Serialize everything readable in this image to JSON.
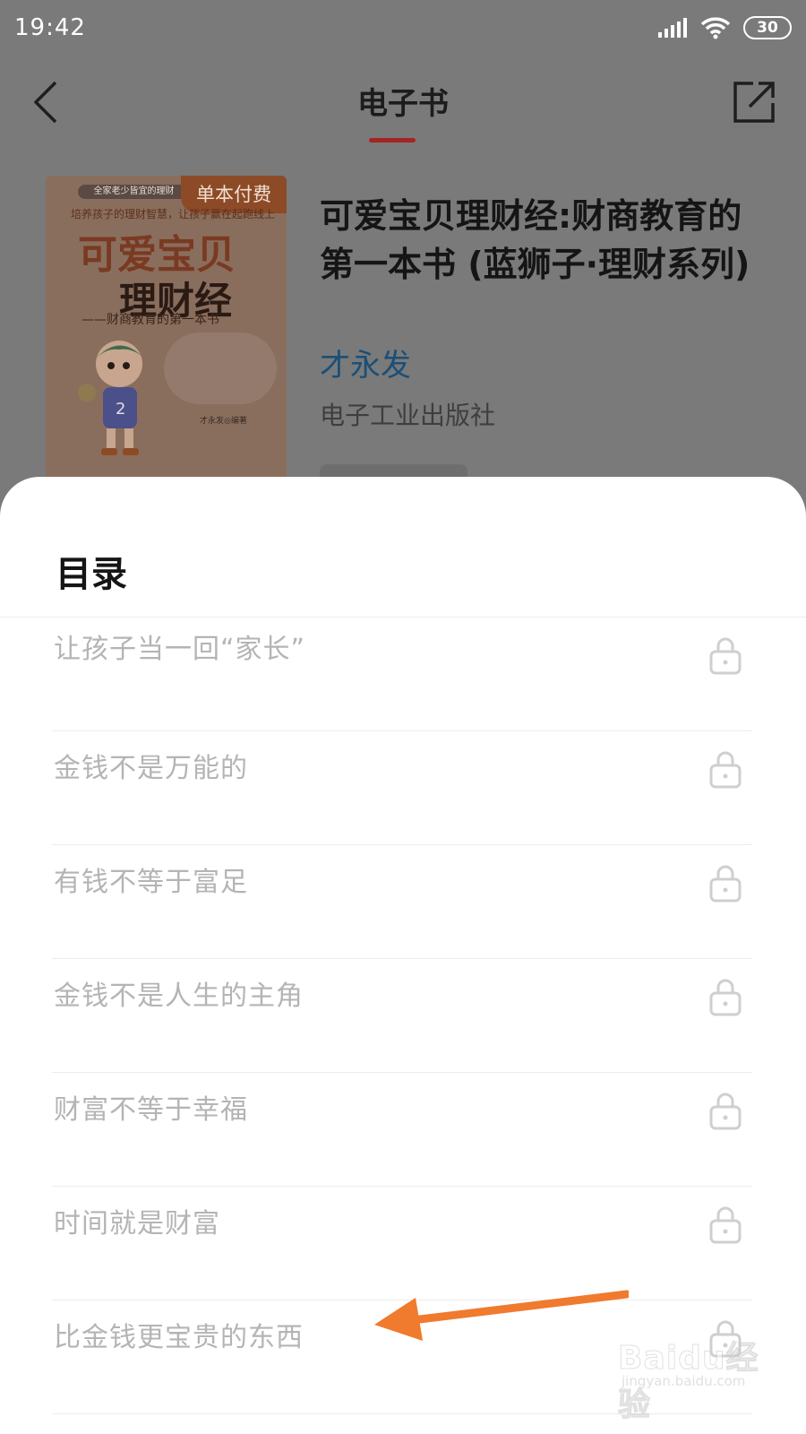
{
  "status_bar": {
    "time": "19:42",
    "battery": "30",
    "icons": [
      "signal-icon",
      "wifi-icon",
      "battery-icon"
    ]
  },
  "header": {
    "title": "电子书",
    "accent_color": "#a52424",
    "icons": [
      "back-arrow-icon",
      "share-icon"
    ]
  },
  "book": {
    "title": "可爱宝贝理财经:财商教育的第一本书 (蓝狮子·理财系列)",
    "author": "才永发",
    "publisher": "电子工业出版社",
    "cover": {
      "badge": "单本付费",
      "top_line": "全家老少皆宜的理财",
      "subtitle": "培养孩子的理财智慧，让孩子赢在起跑线上",
      "title_line1": "可爱宝贝",
      "title_line2": "理财经",
      "tagline": "——财商教育的第一本书",
      "author_line": "才永发◎编著"
    }
  },
  "toc": {
    "title": "目录",
    "items": [
      {
        "label": "让孩子当一回“家长”",
        "locked": true
      },
      {
        "label": "金钱不是万能的",
        "locked": true
      },
      {
        "label": "有钱不等于富足",
        "locked": true
      },
      {
        "label": "金钱不是人生的主角",
        "locked": true
      },
      {
        "label": "财富不等于幸福",
        "locked": true
      },
      {
        "label": "时间就是财富",
        "locked": true
      },
      {
        "label": "比金钱更宝贵的东西",
        "locked": true
      }
    ]
  },
  "annotation": {
    "arrow_color": "#f07a2e"
  },
  "watermark": {
    "main": "Baidu经验",
    "sub": "jingyan.baidu.com"
  }
}
